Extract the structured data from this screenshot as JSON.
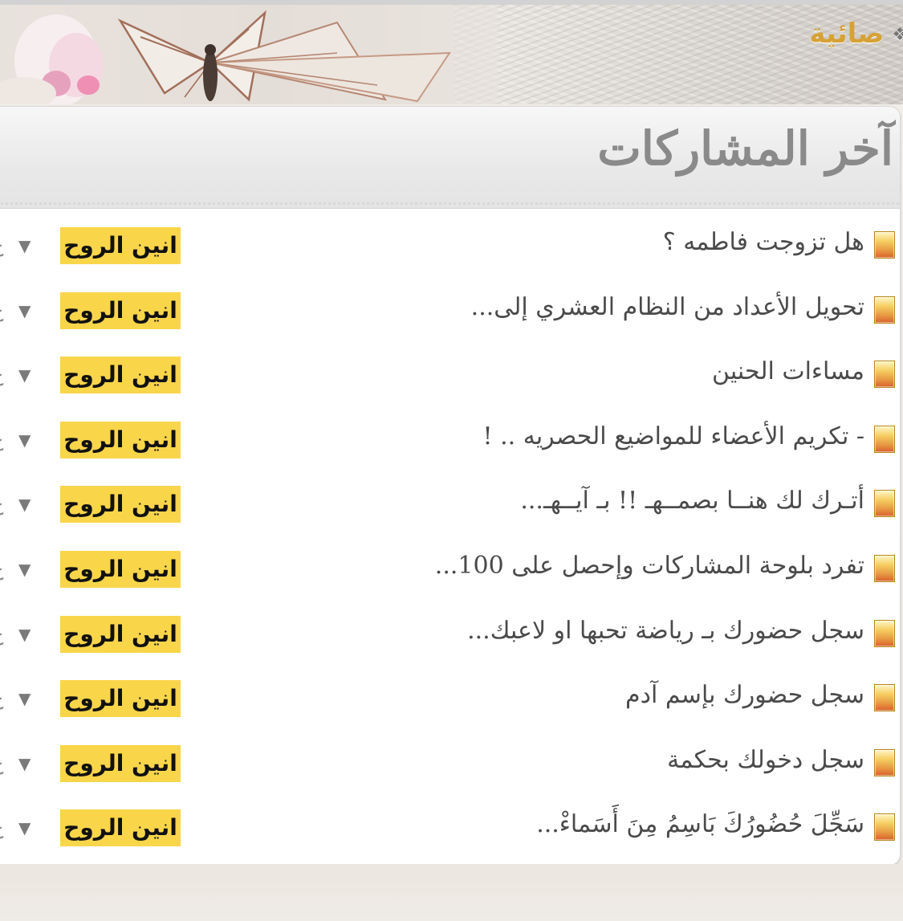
{
  "banner": {
    "title": "صائية",
    "mark": "❖"
  },
  "panel": {
    "title": "آخر المشاركات"
  },
  "posts": [
    {
      "topic": "هل تزوجت فاطمه ؟",
      "author": "انين الروح"
    },
    {
      "topic": "تحويل الأعداد من النظام العشري إلى...",
      "author": "انين الروح"
    },
    {
      "topic": "مساءات الحنين",
      "author": "انين الروح"
    },
    {
      "topic": "- تكريم الأعضاء للمواضيع الحصريه .. !",
      "author": "انين الروح"
    },
    {
      "topic": "أتـرك لك هنــا بصمــهـ !! بـ آيــهـ...",
      "author": "انين الروح"
    },
    {
      "topic": "تفرد بلوحة المشاركات وإحصل على 100...",
      "author": "انين الروح"
    },
    {
      "topic": "سجل حضورك بـ رياضة تحبها او لاعبك...",
      "author": "انين الروح"
    },
    {
      "topic": "سجل حضورك بإسم آدم",
      "author": "انين الروح"
    },
    {
      "topic": "سجل دخولك بحكمة",
      "author": "انين الروح"
    },
    {
      "topic": "سَجِّلَ حُضُورُكَ بَاسِمُ مِنَ أَسَماءْ...",
      "author": "انين الروح"
    }
  ],
  "arrow_glyph": "▼",
  "edge_glyph": "ع",
  "colors": {
    "author_highlight": "#f9d54a",
    "title_gray": "#8a8a8a",
    "banner_gold": "#d6a236"
  }
}
